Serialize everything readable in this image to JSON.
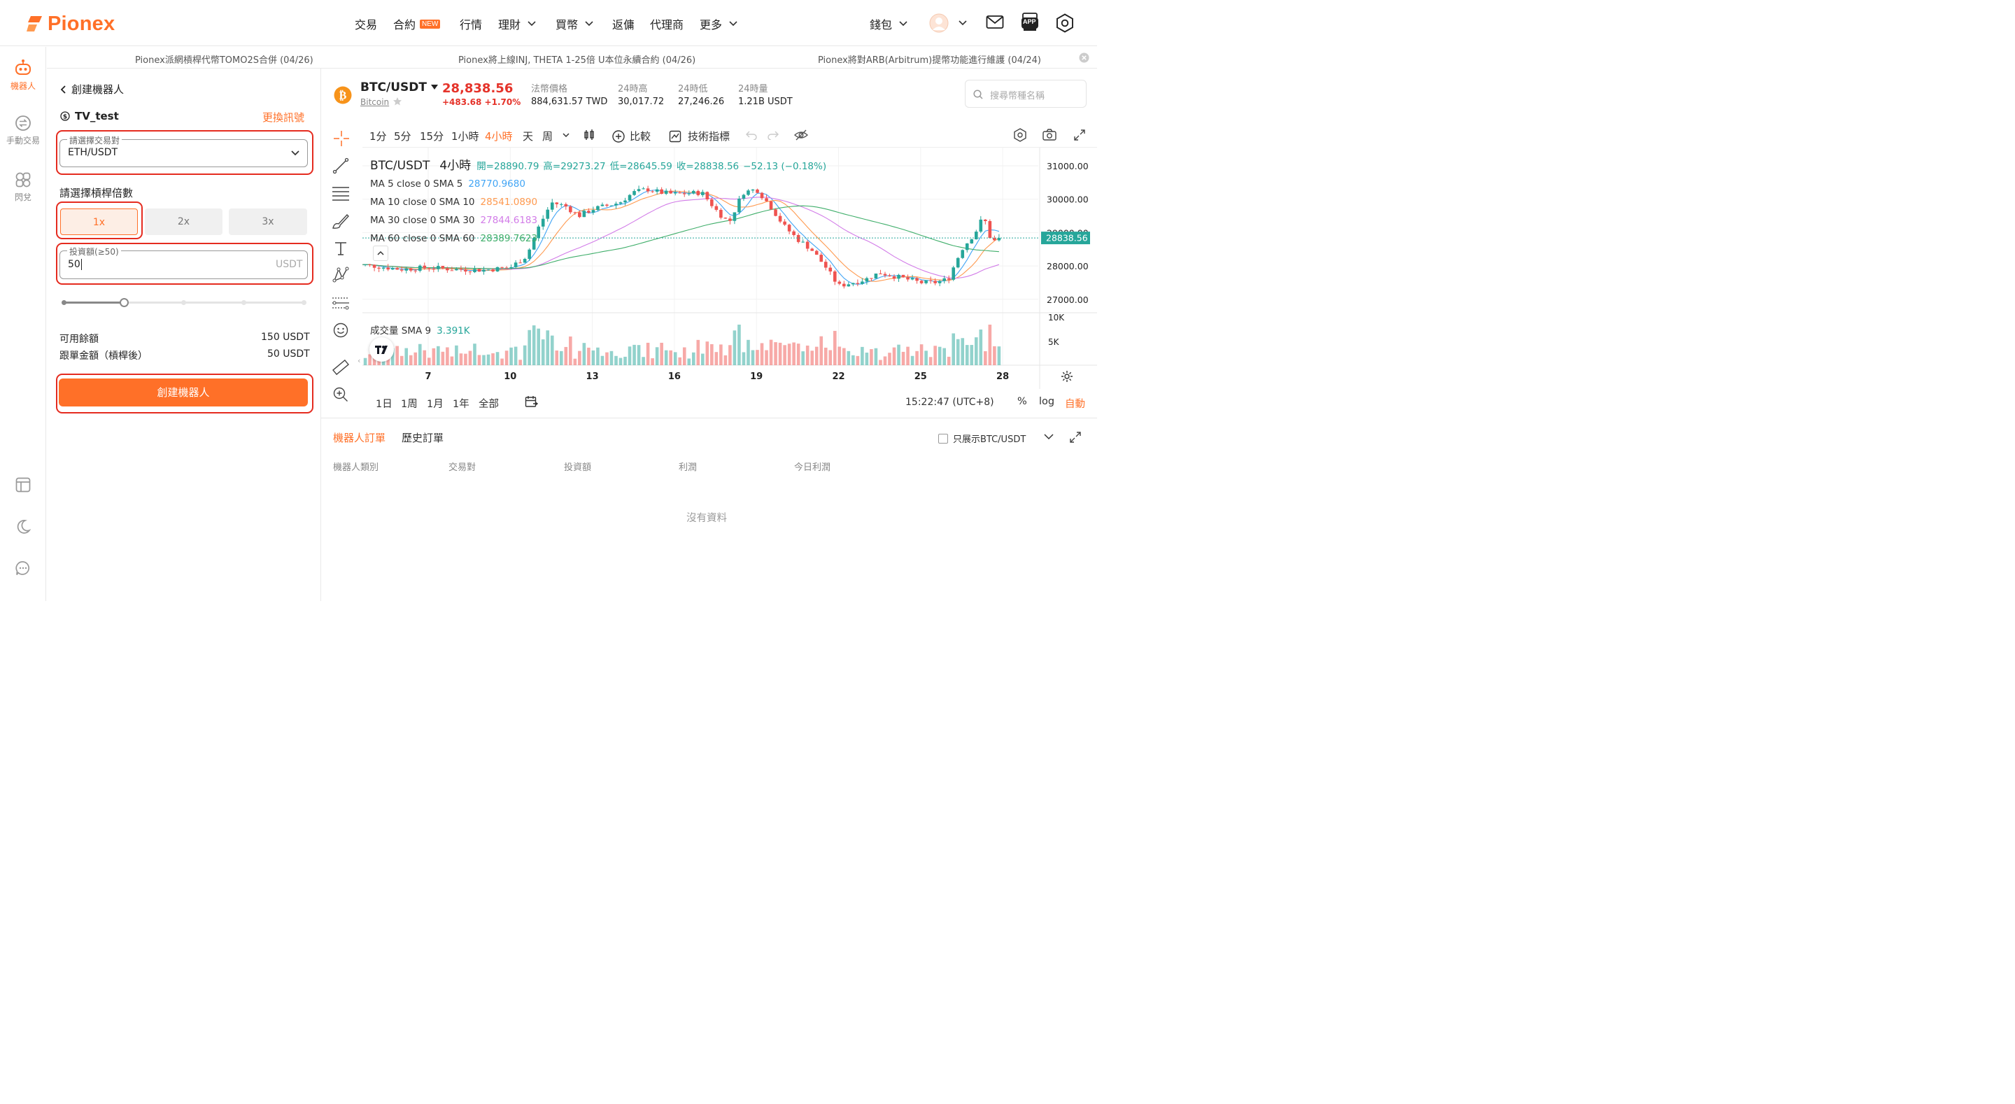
{
  "brand": {
    "name": "Pionex",
    "color": "#ff7028"
  },
  "nav": {
    "trade": "交易",
    "contract": "合約",
    "contract_badge": "NEW",
    "market": "行情",
    "finance": "理財",
    "buy_crypto": "買幣",
    "rebate": "返傭",
    "agent": "代理商",
    "more": "更多",
    "wallet": "錢包",
    "app_badge": "APP"
  },
  "sidebar": {
    "items": [
      {
        "label": "機器人",
        "icon": "robot-icon",
        "active": true
      },
      {
        "label": "手動交易",
        "icon": "exchange-icon",
        "active": false
      },
      {
        "label": "閃兌",
        "icon": "swap-circles-icon",
        "active": false
      }
    ],
    "bottom_icons": [
      "layout-icon",
      "moon-icon",
      "chat-icon"
    ]
  },
  "news": {
    "items": [
      "Pionex派網槓桿代幣TOMO2S合併 (04/26)",
      "Pionex將上線INJ, THETA 1-25倍 U本位永續合約 (04/26)",
      "Pionex將對ARB(Arbitrum)提幣功能進行維護 (04/24)"
    ]
  },
  "left_panel": {
    "back_title": "創建機器人",
    "strategy_name": "TV_test",
    "change_signal": "更換訊號",
    "pair_legend": "請選擇交易對",
    "pair_value": "ETH/USDT",
    "leverage_title": "請選擇槓桿倍數",
    "leverage_options": [
      "1x",
      "2x",
      "3x"
    ],
    "selected_leverage": "1x",
    "invest_legend": "投資額(≥50)",
    "invest_value": "50",
    "invest_unit": "USDT",
    "slider_level": 0.25,
    "available_label": "可用餘額",
    "available_value": "150 USDT",
    "follow_label": "跟單金額（槓桿後）",
    "follow_value": "50 USDT",
    "create_button": "創建機器人"
  },
  "ticker": {
    "pair": "BTC/USDT",
    "coin_name": "Bitcoin",
    "price": "28,838.56",
    "change": "+483.68 +1.70%",
    "fiat_label": "法幣價格",
    "fiat_value": "884,631.57 TWD",
    "high_label": "24時高",
    "high_value": "30,017.72",
    "low_label": "24時低",
    "low_value": "27,246.26",
    "vol_label": "24時量",
    "vol_value": "1.21B USDT",
    "search_placeholder": "搜尋幣種名稱"
  },
  "chart_toolbar": {
    "timeframes": [
      "1分",
      "5分",
      "15分",
      "1小時",
      "4小時",
      "天",
      "周"
    ],
    "active_timeframe": "4小時",
    "compare": "比較",
    "indicators": "技術指標"
  },
  "chart_data": {
    "type": "candlestick",
    "symbol": "BTC/USDT",
    "interval": "4小時",
    "ohlc_text": {
      "open": "開=28890.79",
      "high": "高=29273.27",
      "low": "低=28645.59",
      "close": "收=28838.56",
      "chg": "−52.13 (−0.18%)"
    },
    "ma_legend": [
      {
        "label": "MA 5 close 0 SMA 5",
        "value": "28770.9680",
        "color": "#42a5f5"
      },
      {
        "label": "MA 10 close 0 SMA 10",
        "value": "28541.0890",
        "color": "#ff9a50"
      },
      {
        "label": "MA 30 close 0 SMA 30",
        "value": "27844.6183",
        "color": "#d27ce8"
      },
      {
        "label": "MA 60 close 0 SMA 60",
        "value": "28389.7623",
        "color": "#3fae6a"
      }
    ],
    "volume_legend": {
      "label": "成交量 SMA 9",
      "value": "3.391K"
    },
    "y_ticks": [
      "31000.00",
      "30000.00",
      "29000.00",
      "28000.00",
      "27000.00"
    ],
    "y_tick_values": [
      31000,
      30000,
      29000,
      28000,
      27000
    ],
    "last_price_label": "28838.56",
    "last_price": 28838.56,
    "vol_ticks": [
      "10K",
      "5K"
    ],
    "x_ticks": [
      "7",
      "10",
      "13",
      "16",
      "19",
      "22",
      "25",
      "28"
    ],
    "x_tick_days": [
      7,
      10,
      13,
      16,
      19,
      22,
      25,
      28
    ],
    "anchor_closes": [
      [
        4.2,
        28050
      ],
      [
        5.0,
        28000
      ],
      [
        6.0,
        27900
      ],
      [
        7.0,
        27950
      ],
      [
        8.0,
        27900
      ],
      [
        9.0,
        27880
      ],
      [
        10.0,
        27950
      ],
      [
        10.6,
        28300
      ],
      [
        11.0,
        29100
      ],
      [
        11.5,
        29900
      ],
      [
        12.0,
        29800
      ],
      [
        12.5,
        29500
      ],
      [
        13.0,
        29700
      ],
      [
        14.0,
        29900
      ],
      [
        14.5,
        30200
      ],
      [
        15.0,
        30300
      ],
      [
        15.5,
        30200
      ],
      [
        16.0,
        30150
      ],
      [
        17.0,
        30200
      ],
      [
        17.6,
        29600
      ],
      [
        18.0,
        29300
      ],
      [
        18.5,
        30200
      ],
      [
        19.0,
        30300
      ],
      [
        19.5,
        29800
      ],
      [
        20.0,
        29200
      ],
      [
        20.5,
        28800
      ],
      [
        21.0,
        28500
      ],
      [
        21.5,
        28000
      ],
      [
        22.0,
        27400
      ],
      [
        22.5,
        27500
      ],
      [
        23.0,
        27600
      ],
      [
        23.5,
        27800
      ],
      [
        24.0,
        27700
      ],
      [
        25.0,
        27500
      ],
      [
        25.5,
        27500
      ],
      [
        26.0,
        27600
      ],
      [
        26.5,
        28500
      ],
      [
        27.0,
        29000
      ],
      [
        27.3,
        29500
      ],
      [
        27.6,
        28700
      ],
      [
        27.9,
        28840
      ]
    ],
    "up_color": "#26a69a",
    "down_color": "#ef5350",
    "bottom_ranges": [
      "1日",
      "1周",
      "1月",
      "1年",
      "全部"
    ],
    "time": "15:22:47 (UTC+8)",
    "scale_options": [
      "%",
      "log",
      "自動"
    ]
  },
  "orders": {
    "tabs": [
      "機器人訂單",
      "歷史訂單"
    ],
    "active_tab": "機器人訂單",
    "filter_label": "只展示BTC/USDT",
    "columns": [
      "機器人類別",
      "交易對",
      "投資額",
      "利潤",
      "今日利潤"
    ],
    "empty": "沒有資料"
  }
}
